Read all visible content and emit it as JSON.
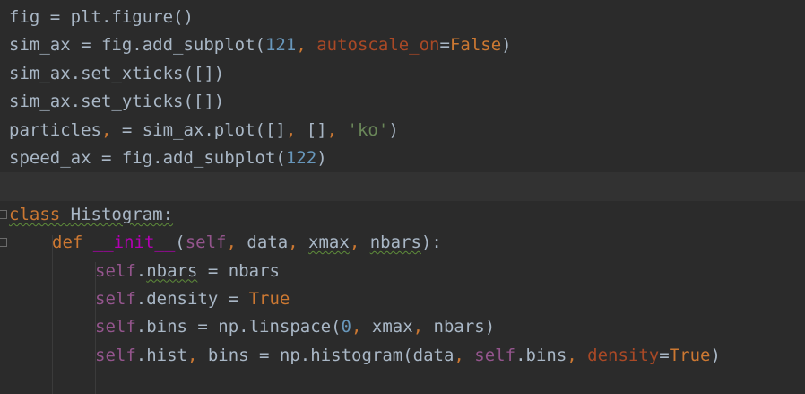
{
  "editor": {
    "lines": [
      {
        "tokens": [
          {
            "t": "fig = plt.figure()",
            "c": "plain"
          }
        ]
      },
      {
        "tokens": [
          {
            "t": "sim_ax = fig.add_subplot(",
            "c": "plain"
          },
          {
            "t": "121",
            "c": "num"
          },
          {
            "t": ", ",
            "c": "kw"
          },
          {
            "t": "autoscale_on",
            "c": "kwarg"
          },
          {
            "t": "=",
            "c": "plain"
          },
          {
            "t": "False",
            "c": "kw"
          },
          {
            "t": ")",
            "c": "plain"
          }
        ]
      },
      {
        "tokens": [
          {
            "t": "sim_ax.set_xticks([])",
            "c": "plain"
          }
        ]
      },
      {
        "tokens": [
          {
            "t": "sim_ax.set_yticks([])",
            "c": "plain"
          }
        ]
      },
      {
        "tokens": [
          {
            "t": "particles",
            "c": "plain"
          },
          {
            "t": ", ",
            "c": "kw"
          },
          {
            "t": "= sim_ax.plot([]",
            "c": "plain"
          },
          {
            "t": ", ",
            "c": "kw"
          },
          {
            "t": "[]",
            "c": "plain"
          },
          {
            "t": ", ",
            "c": "kw"
          },
          {
            "t": "'ko'",
            "c": "str"
          },
          {
            "t": ")",
            "c": "plain"
          }
        ]
      },
      {
        "tokens": [
          {
            "t": "speed_ax = fig.add_subplot(",
            "c": "plain"
          },
          {
            "t": "122",
            "c": "num"
          },
          {
            "t": ")",
            "c": "plain"
          }
        ]
      },
      {
        "tokens": []
      },
      {
        "tokens": [
          {
            "t": "class ",
            "c": "kw typo"
          },
          {
            "t": "Histogram",
            "c": "plain typo"
          },
          {
            "t": ":",
            "c": "plain typo"
          }
        ]
      },
      {
        "tokens": [
          {
            "t": "def ",
            "c": "kw"
          },
          {
            "t": "__init__",
            "c": "dunder"
          },
          {
            "t": "(",
            "c": "plain"
          },
          {
            "t": "self",
            "c": "self"
          },
          {
            "t": ", ",
            "c": "kw"
          },
          {
            "t": "data",
            "c": "plain"
          },
          {
            "t": ", ",
            "c": "kw"
          },
          {
            "t": "xmax",
            "c": "plain typo"
          },
          {
            "t": ", ",
            "c": "kw"
          },
          {
            "t": "nbars",
            "c": "plain typo"
          },
          {
            "t": "):",
            "c": "plain"
          }
        ]
      },
      {
        "tokens": [
          {
            "t": "self",
            "c": "self"
          },
          {
            "t": ".",
            "c": "plain"
          },
          {
            "t": "nbars",
            "c": "plain typo"
          },
          {
            "t": " = nbars",
            "c": "plain"
          }
        ]
      },
      {
        "tokens": [
          {
            "t": "self",
            "c": "self"
          },
          {
            "t": ".density = ",
            "c": "plain"
          },
          {
            "t": "True",
            "c": "kw"
          }
        ]
      },
      {
        "tokens": [
          {
            "t": "self",
            "c": "self"
          },
          {
            "t": ".bins = np.linspace(",
            "c": "plain"
          },
          {
            "t": "0",
            "c": "num"
          },
          {
            "t": ", ",
            "c": "kw"
          },
          {
            "t": "xmax",
            "c": "plain"
          },
          {
            "t": ", ",
            "c": "kw"
          },
          {
            "t": "nbars)",
            "c": "plain"
          }
        ]
      },
      {
        "tokens": [
          {
            "t": "self",
            "c": "self"
          },
          {
            "t": ".hist",
            "c": "plain"
          },
          {
            "t": ", ",
            "c": "kw"
          },
          {
            "t": "bins = np.histogram(data",
            "c": "plain"
          },
          {
            "t": ", ",
            "c": "kw"
          },
          {
            "t": "self",
            "c": "self"
          },
          {
            "t": ".bins",
            "c": "plain"
          },
          {
            "t": ", ",
            "c": "kw"
          },
          {
            "t": "density",
            "c": "kwarg"
          },
          {
            "t": "=",
            "c": "plain"
          },
          {
            "t": "True",
            "c": "kw"
          },
          {
            "t": ")",
            "c": "plain"
          }
        ]
      },
      {
        "tokens": []
      }
    ]
  }
}
